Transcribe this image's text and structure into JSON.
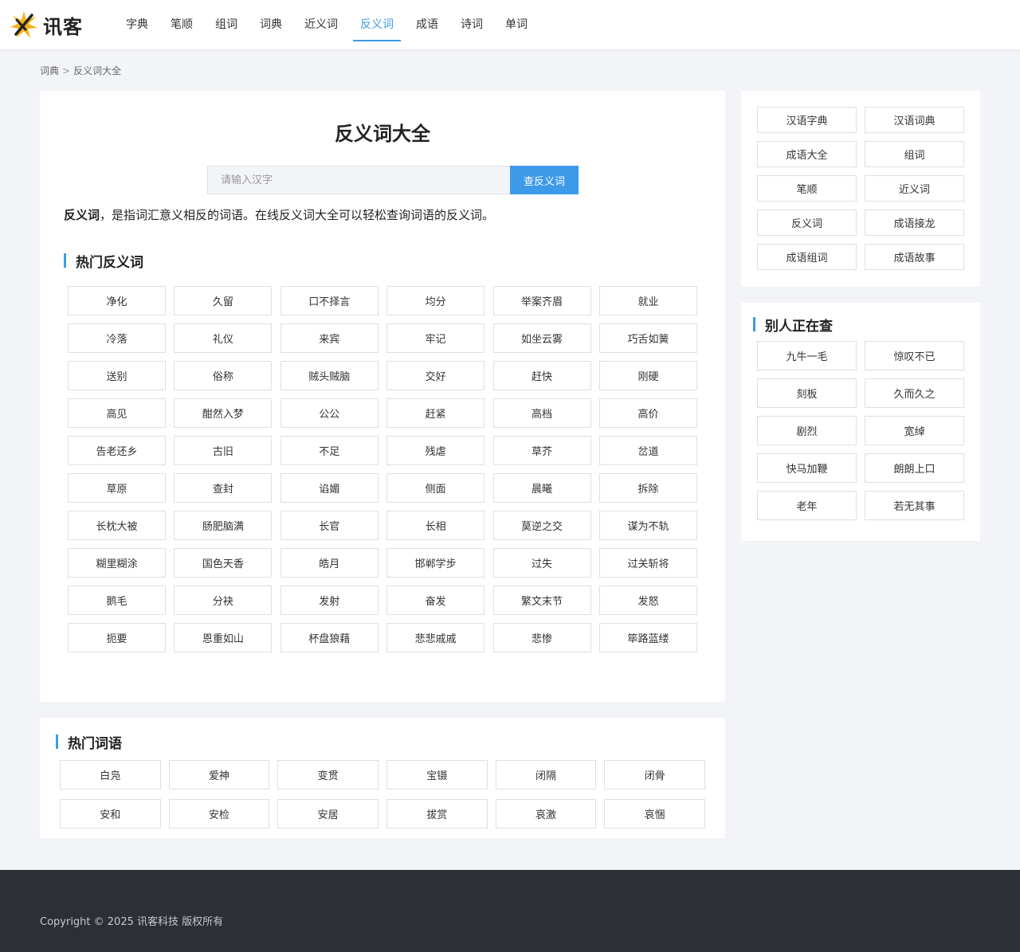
{
  "header": {
    "logo_text": "讯客",
    "nav": [
      {
        "label": "字典",
        "active": false
      },
      {
        "label": "笔顺",
        "active": false
      },
      {
        "label": "组词",
        "active": false
      },
      {
        "label": "词典",
        "active": false
      },
      {
        "label": "近义词",
        "active": false
      },
      {
        "label": "反义词",
        "active": true
      },
      {
        "label": "成语",
        "active": false
      },
      {
        "label": "诗词",
        "active": false
      },
      {
        "label": "单词",
        "active": false
      }
    ]
  },
  "breadcrumb": {
    "items": [
      "词典",
      "反义词大全"
    ],
    "separator": ">"
  },
  "main": {
    "title": "反义词大全",
    "search": {
      "placeholder": "请输入汉字",
      "value": "",
      "button_label": "查反义词"
    },
    "intro_term": "反义词",
    "intro_text": "，是指词汇意义相反的词语。在线反义词大全可以轻松查询词语的反义词。",
    "hot_title": "热门反义词",
    "hot_words": [
      "净化",
      "久留",
      "口不择言",
      "均分",
      "举案齐眉",
      "就业",
      "冷落",
      "礼仪",
      "来宾",
      "牢记",
      "如坐云雾",
      "巧舌如簧",
      "送别",
      "俗称",
      "贼头贼脑",
      "交好",
      "赶快",
      "刚硬",
      "高见",
      "酣然入梦",
      "公公",
      "赶紧",
      "高档",
      "高价",
      "告老还乡",
      "古旧",
      "不足",
      "残虐",
      "草芥",
      "岔道",
      "草原",
      "查封",
      "谄媚",
      "侧面",
      "晨曦",
      "拆除",
      "长枕大被",
      "肠肥脑满",
      "长官",
      "长相",
      "莫逆之交",
      "谋为不轨",
      "糊里糊涂",
      "国色天香",
      "皓月",
      "邯郸学步",
      "过失",
      "过关斩将",
      "鹅毛",
      "分袂",
      "发射",
      "奋发",
      "繁文末节",
      "发怒",
      "扼要",
      "恩重如山",
      "杯盘狼藉",
      "悲悲戚戚",
      "悲惨",
      "筚路蓝缕"
    ]
  },
  "sidebar": {
    "links": [
      "汉语字典",
      "汉语词典",
      "成语大全",
      "组词",
      "笔顺",
      "近义词",
      "反义词",
      "成语接龙",
      "成语组词",
      "成语故事"
    ],
    "recent_title": "别人正在查",
    "recent": [
      "九牛一毛",
      "惊叹不已",
      "刻板",
      "久而久之",
      "剧烈",
      "宽绰",
      "快马加鞭",
      "朗朗上口",
      "老年",
      "若无其事"
    ]
  },
  "hot_terms": {
    "title": "热门词语",
    "items": [
      "白凫",
      "爱神",
      "变贯",
      "宝镊",
      "闭隔",
      "闭骨",
      "安和",
      "安检",
      "安居",
      "拔赏",
      "哀激",
      "哀悃"
    ]
  },
  "footer": {
    "copyright": "Copyright © 2025 讯客科技 版权所有"
  },
  "colors": {
    "accent": "#3c9ae8",
    "footer_bg": "#2c2f36",
    "page_bg": "#f2f4f7"
  }
}
